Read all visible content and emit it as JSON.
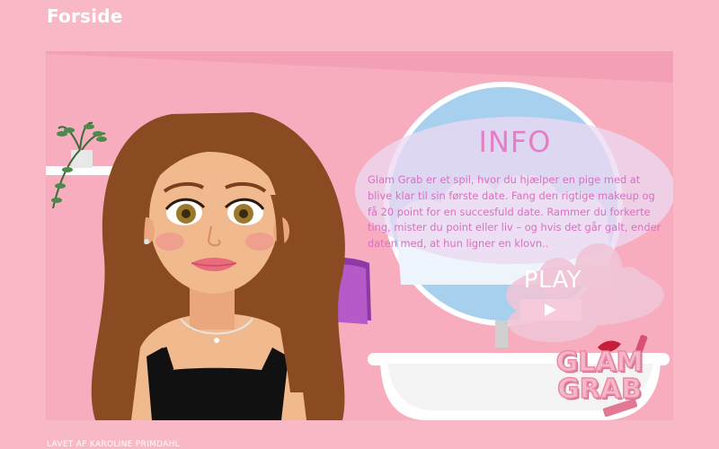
{
  "header": {
    "title": "Forside"
  },
  "info": {
    "title": "INFO",
    "text": "Glam Grab er et spil, hvor du hjælper en pige med at blive klar til sin første date. Fang den rigtige makeup og få 20 point for en succesfuld date. Rammer du forkerte ting, mister du point eller liv – og hvis det går galt, ender daten med, at hun ligner en klovn.."
  },
  "play": {
    "label": "PLAY"
  },
  "logo": {
    "line1": "GLAM",
    "line2": "GRAB",
    "icon_top": "lips-icon",
    "icon_bottom": "lipstick-icon"
  },
  "footer": {
    "credit": "LAVET AF KAROLINE PRIMDAHL"
  },
  "colors": {
    "page_background": "#f9b8c6",
    "stage_background": "#f7a9bd",
    "info_text": "#db6fc0",
    "info_title": "#e77cc7",
    "hair": "#8a4a22",
    "top": "#111111"
  }
}
